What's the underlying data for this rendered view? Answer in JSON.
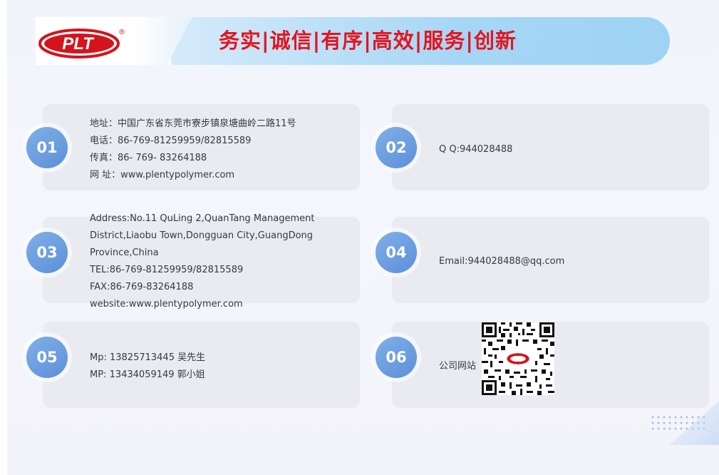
{
  "header": {
    "logo_text": "PLT",
    "logo_mark": "®",
    "slogan": "务实|诚信|有序|高效|服务|创新"
  },
  "cards": {
    "c01": {
      "number": "01",
      "lines": [
        "地址：中国广东省东莞市寮步镇泉塘曲岭二路11号",
        "电话：86-769-81259959/82815589",
        "传真：86- 769- 83264188",
        "网 址：www.plentypolymer.com"
      ]
    },
    "c02": {
      "number": "02",
      "lines": [
        "Q  Q:944028488"
      ]
    },
    "c03": {
      "number": "03",
      "lines": [
        "Address:No.11 QuLing 2,QuanTang Management",
        "District,Liaobu   Town,Dongguan City,GuangDong",
        "Province,China",
        "TEL:86-769-81259959/82815589",
        "FAX:86-769-83264188",
        "website:www.plentypolymer.com"
      ]
    },
    "c04": {
      "number": "04",
      "lines": [
        "Email:944028488@qq.com"
      ]
    },
    "c05": {
      "number": "05",
      "lines": [
        "Mp: 13825713445  吴先生",
        "MP: 13434059149  郭小姐"
      ]
    },
    "c06": {
      "number": "06",
      "lines": [
        "公司网站"
      ]
    }
  }
}
